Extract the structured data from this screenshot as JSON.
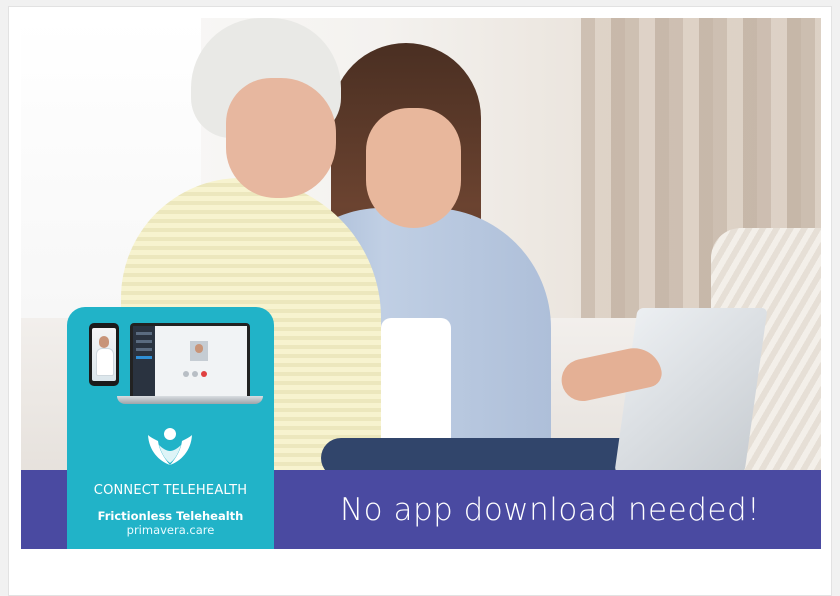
{
  "banner": {
    "tagline": "No app download needed!",
    "band_color": "#4a4aa1",
    "card_color": "#21b3c8"
  },
  "card": {
    "title": "CONNECT TELEHEALTH",
    "subtitle": "Frictionless Telehealth",
    "url": "primavera.care",
    "logo_icon": "primavera-logo-icon",
    "phone_icon": "phone-video-call-icon",
    "laptop_icon": "laptop-video-call-icon"
  }
}
